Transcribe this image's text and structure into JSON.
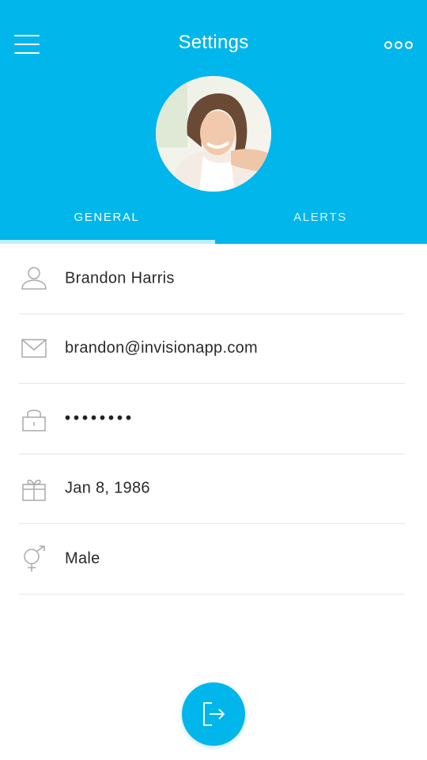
{
  "colors": {
    "accent": "#00b6ea",
    "tab_indicator": "#bfeefa",
    "text": "#2a2a2a",
    "icon": "#aaaaaa",
    "divider": "#e6e6e6"
  },
  "header": {
    "title": "Settings",
    "menu_icon": "hamburger-menu-icon",
    "more_icon": "more-options-icon"
  },
  "tabs": [
    {
      "label": "GENERAL",
      "active": true
    },
    {
      "label": "ALERTS",
      "active": false
    }
  ],
  "fields": [
    {
      "icon": "user-icon",
      "value": "Brandon Harris"
    },
    {
      "icon": "envelope-icon",
      "value": "brandon@invisionapp.com"
    },
    {
      "icon": "lock-icon",
      "value": "••••••••"
    },
    {
      "icon": "gift-icon",
      "value": "Jan 8, 1986"
    },
    {
      "icon": "gender-icon",
      "value": "Male"
    }
  ],
  "logout": {
    "icon": "logout-icon"
  }
}
